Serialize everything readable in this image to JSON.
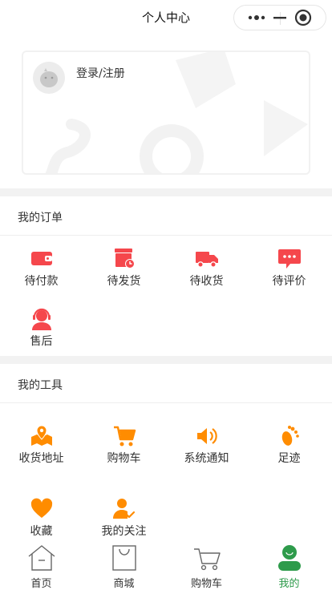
{
  "app": {
    "title": "个人中心"
  },
  "profile": {
    "login_label": "登录/注册"
  },
  "orders": {
    "title": "我的订单",
    "items": [
      {
        "label": "待付款",
        "icon": "wallet-icon"
      },
      {
        "label": "待发货",
        "icon": "pending-ship-icon"
      },
      {
        "label": "待收货",
        "icon": "delivery-truck-icon"
      },
      {
        "label": "待评价",
        "icon": "comment-icon"
      },
      {
        "label": "售后",
        "icon": "customer-service-icon"
      }
    ]
  },
  "tools": {
    "title": "我的工具",
    "items": [
      {
        "label": "收货地址",
        "icon": "map-pin-icon"
      },
      {
        "label": "购物车",
        "icon": "cart-icon"
      },
      {
        "label": "系统通知",
        "icon": "speaker-icon"
      },
      {
        "label": "足迹",
        "icon": "footprint-icon"
      },
      {
        "label": "收藏",
        "icon": "heart-icon"
      },
      {
        "label": "我的关注",
        "icon": "follow-user-icon"
      }
    ]
  },
  "tabbar": {
    "items": [
      {
        "label": "首页",
        "icon": "home-icon"
      },
      {
        "label": "商城",
        "icon": "shopping-bag-icon"
      },
      {
        "label": "购物车",
        "icon": "cart-icon"
      },
      {
        "label": "我的",
        "icon": "profile-icon",
        "active": true
      }
    ]
  },
  "colors": {
    "order_icon": "#f5474c",
    "tool_icon": "#ff8c00",
    "tab_active": "#2e9b4b",
    "section_gap": "#f2f2f2"
  }
}
